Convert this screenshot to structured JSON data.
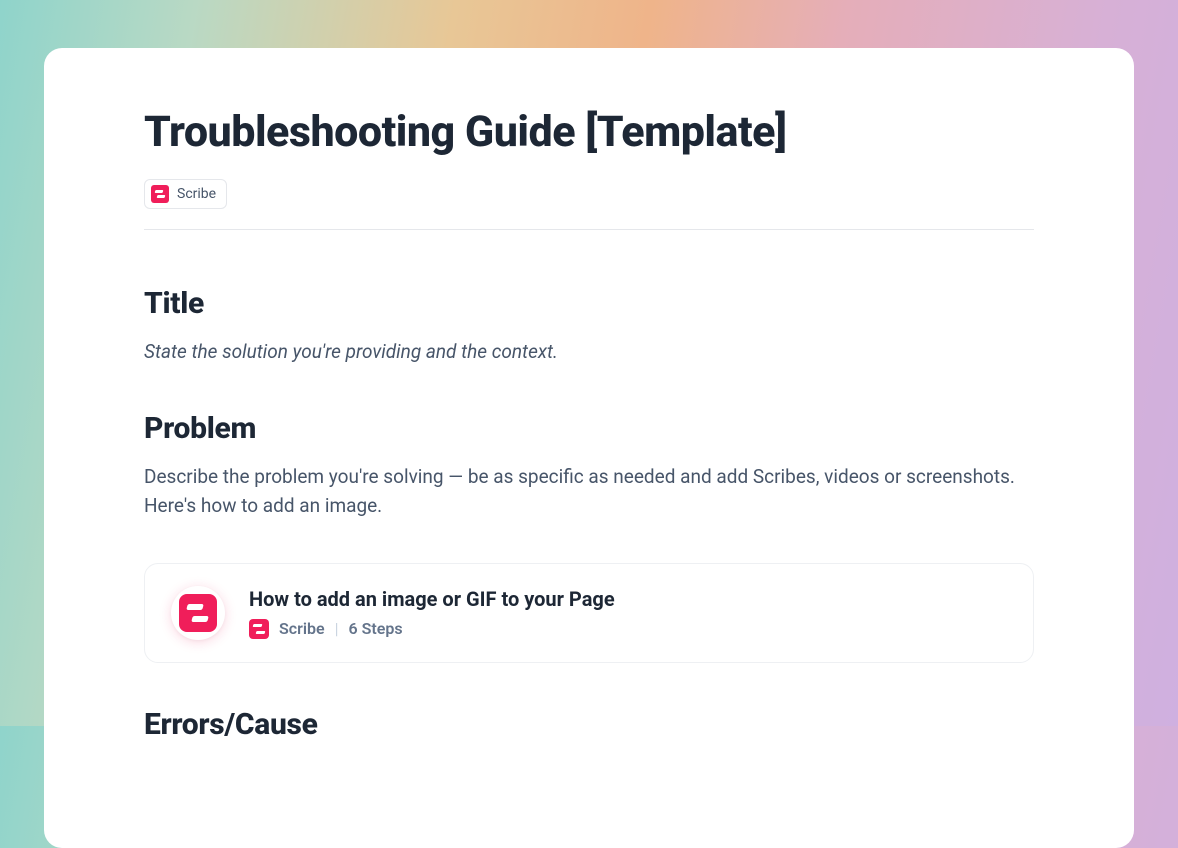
{
  "doc": {
    "title": "Troubleshooting Guide [Template]",
    "tag": {
      "label": "Scribe"
    }
  },
  "sections": {
    "title": {
      "heading": "Title",
      "desc": "State the solution you're providing and the context."
    },
    "problem": {
      "heading": "Problem",
      "desc": "Describe the problem you're solving — be as specific as needed and add Scribes, videos or screenshots. Here's how to add an image."
    },
    "errors": {
      "heading": "Errors/Cause"
    }
  },
  "embed": {
    "title": "How to add an image or GIF to your Page",
    "source": "Scribe",
    "steps_label": "6 Steps"
  }
}
